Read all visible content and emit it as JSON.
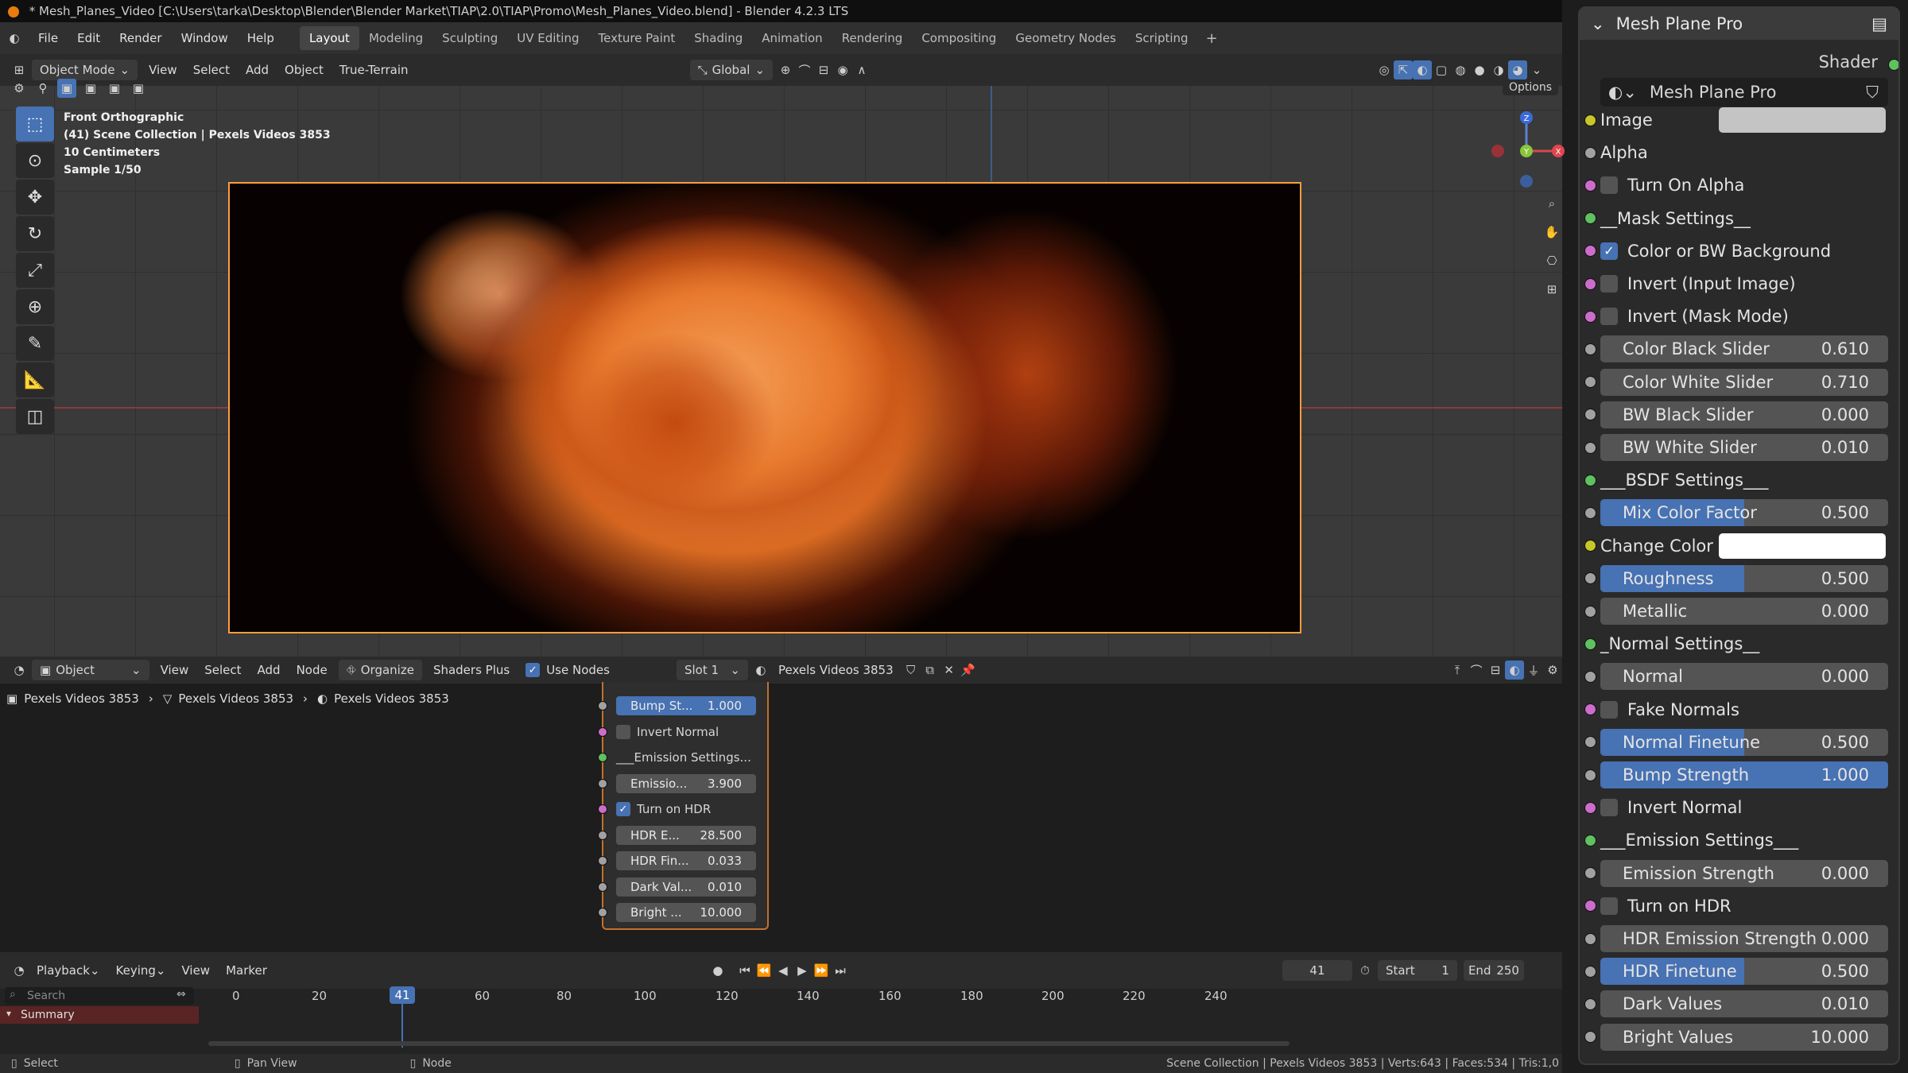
{
  "title_bar": "* Mesh_Planes_Video [C:\\Users\\tarka\\Desktop\\Blender\\Blender Market\\TIAP\\2.0\\TIAP\\Promo\\Mesh_Planes_Video.blend] - Blender 4.2.3 LTS",
  "menu": [
    "File",
    "Edit",
    "Render",
    "Window",
    "Help"
  ],
  "workspaces": [
    "Layout",
    "Modeling",
    "Sculpting",
    "UV Editing",
    "Texture Paint",
    "Shading",
    "Animation",
    "Rendering",
    "Compositing",
    "Geometry Nodes",
    "Scripting"
  ],
  "active_workspace": "Layout",
  "viewport_header": {
    "mode": "Object Mode",
    "items": [
      "View",
      "Select",
      "Add",
      "Object",
      "True-Terrain"
    ],
    "orientation": "Global",
    "options": "Options"
  },
  "viewport_overlay": {
    "line1": "Front Orthographic",
    "line2": "(41) Scene Collection | Pexels Videos 3853",
    "line3": "10 Centimeters",
    "line4": "Sample 1/50"
  },
  "gizmo": {
    "z": "Z",
    "y": "Y",
    "x": "X"
  },
  "node_header": {
    "mode": "Object",
    "items": [
      "View",
      "Select",
      "Add",
      "Node"
    ],
    "organize": "Organize",
    "shaders_plus": "Shaders Plus",
    "use_nodes": "Use Nodes",
    "slot": "Slot 1",
    "material": "Pexels Videos 3853"
  },
  "breadcrumb": [
    "Pexels Videos 3853",
    "Pexels Videos 3853",
    "Pexels Videos 3853"
  ],
  "node_rows": [
    {
      "type": "field",
      "label": "Bump St...",
      "value": "1.000",
      "blue": true,
      "sock": "gray"
    },
    {
      "type": "check",
      "label": "Invert Normal",
      "checked": false,
      "sock": "pink"
    },
    {
      "type": "text",
      "label": "___Emission Settings...",
      "sock": "green"
    },
    {
      "type": "field",
      "label": "Emissio...",
      "value": "3.900",
      "blue": false,
      "sock": "gray"
    },
    {
      "type": "check",
      "label": "Turn on HDR",
      "checked": true,
      "sock": "pink"
    },
    {
      "type": "field",
      "label": "HDR E...",
      "value": "28.500",
      "blue": false,
      "sock": "gray"
    },
    {
      "type": "field",
      "label": "HDR Fin...",
      "value": "0.033",
      "blue": false,
      "sock": "gray"
    },
    {
      "type": "field",
      "label": "Dark Val...",
      "value": "0.010",
      "blue": false,
      "sock": "gray"
    },
    {
      "type": "field",
      "label": "Bright ...",
      "value": "10.000",
      "blue": false,
      "sock": "gray"
    }
  ],
  "timeline": {
    "items": [
      "Playback",
      "Keying",
      "View",
      "Marker"
    ],
    "current_frame": "41",
    "start_label": "Start",
    "start": "1",
    "end_label": "End",
    "end": "250",
    "search_placeholder": "Search",
    "summary": "Summary",
    "ticks": [
      "0",
      "20",
      "41",
      "60",
      "80",
      "100",
      "120",
      "140",
      "160",
      "180",
      "200",
      "220",
      "240"
    ]
  },
  "status_bar": {
    "left": "Select",
    "middle": "Pan View",
    "right": "Node",
    "stats": "Scene Collection | Pexels Videos 3853 | Verts:643 | Faces:534 | Tris:1,0"
  },
  "panel": {
    "title": "Mesh Plane Pro",
    "shader_label": "Shader",
    "node_group": "Mesh Plane Pro",
    "rows": [
      {
        "type": "swatch",
        "label": "Image",
        "color": "#c4c4c4",
        "sock": "yellow"
      },
      {
        "type": "text",
        "label": "Alpha",
        "sock": "gray"
      },
      {
        "type": "check",
        "label": "Turn On Alpha",
        "checked": false,
        "sock": "pink"
      },
      {
        "type": "text",
        "label": "__Mask Settings__",
        "sock": "green"
      },
      {
        "type": "check",
        "label": "Color or  BW Background",
        "checked": true,
        "sock": "pink"
      },
      {
        "type": "check",
        "label": "Invert (Input Image)",
        "checked": false,
        "sock": "pink"
      },
      {
        "type": "check",
        "label": "Invert (Mask Mode)",
        "checked": false,
        "sock": "pink"
      },
      {
        "type": "field",
        "label": "Color Black Slider",
        "value": "0.610",
        "fill": 0,
        "sock": "gray"
      },
      {
        "type": "field",
        "label": "Color White Slider",
        "value": "0.710",
        "fill": 0,
        "sock": "gray"
      },
      {
        "type": "field",
        "label": "BW Black Slider",
        "value": "0.000",
        "fill": 0,
        "sock": "gray"
      },
      {
        "type": "field",
        "label": "BW White Slider",
        "value": "0.010",
        "fill": 0,
        "sock": "gray"
      },
      {
        "type": "text",
        "label": "___BSDF Settings___",
        "sock": "green"
      },
      {
        "type": "field",
        "label": "Mix Color Factor",
        "value": "0.500",
        "fill": 0.5,
        "sock": "gray"
      },
      {
        "type": "swatch",
        "label": "Change Color",
        "color": "#ffffff",
        "sock": "yellow"
      },
      {
        "type": "field",
        "label": "Roughness",
        "value": "0.500",
        "fill": 0.5,
        "sock": "gray"
      },
      {
        "type": "field",
        "label": "Metallic",
        "value": "0.000",
        "fill": 0,
        "sock": "gray"
      },
      {
        "type": "text",
        "label": "_Normal Settings__",
        "sock": "green"
      },
      {
        "type": "field",
        "label": "Normal",
        "value": "0.000",
        "fill": 0,
        "sock": "gray"
      },
      {
        "type": "check",
        "label": "Fake Normals",
        "checked": false,
        "sock": "pink"
      },
      {
        "type": "field",
        "label": "Normal Finetune",
        "value": "0.500",
        "fill": 0.5,
        "sock": "gray"
      },
      {
        "type": "field",
        "label": "Bump Strength",
        "value": "1.000",
        "fill": 1,
        "sock": "gray"
      },
      {
        "type": "check",
        "label": "Invert Normal",
        "checked": false,
        "sock": "pink"
      },
      {
        "type": "text",
        "label": "___Emission Settings___",
        "sock": "green"
      },
      {
        "type": "field",
        "label": "Emission Strength",
        "value": "0.000",
        "fill": 0,
        "sock": "gray"
      },
      {
        "type": "check",
        "label": "Turn on HDR",
        "checked": false,
        "sock": "pink"
      },
      {
        "type": "field",
        "label": "HDR Emission Strength",
        "value": "0.000",
        "fill": 0,
        "sock": "gray"
      },
      {
        "type": "field",
        "label": "HDR Finetune",
        "value": "0.500",
        "fill": 0.5,
        "sock": "gray"
      },
      {
        "type": "field",
        "label": "Dark Values",
        "value": "0.010",
        "fill": 0,
        "sock": "gray"
      },
      {
        "type": "field",
        "label": "Bright Values",
        "value": "10.000",
        "fill": 0,
        "sock": "gray"
      }
    ]
  },
  "colors": {
    "accent": "#4772b3",
    "selection_outline": "#ff9d3f",
    "node_outline": "#c4702c"
  }
}
